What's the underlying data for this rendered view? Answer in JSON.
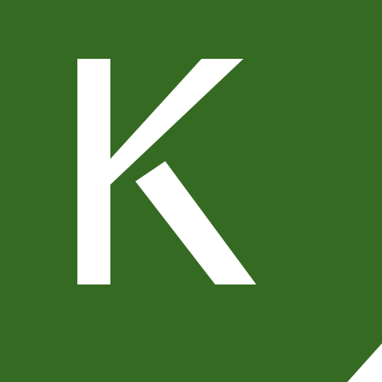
{
  "logo": {
    "letter": "K",
    "background_color": "#356a22",
    "letter_color": "#ffffff"
  }
}
